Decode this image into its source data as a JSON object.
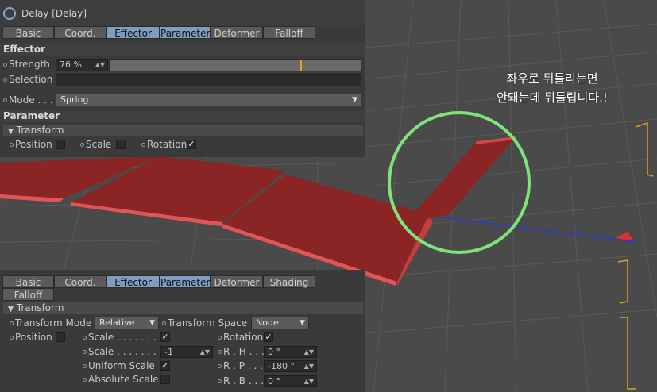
{
  "app": {
    "title": "Delay [Delay]",
    "logo_icon": "delay-effector-icon"
  },
  "top_panel": {
    "tabs": [
      {
        "label": "Basic",
        "active": false
      },
      {
        "label": "Coord.",
        "active": false
      },
      {
        "label": "Effector",
        "active": true
      },
      {
        "label": "Parameter",
        "active": true
      },
      {
        "label": "Deformer",
        "active": false
      },
      {
        "label": "Falloff",
        "active": false
      }
    ],
    "effector_section": "Effector",
    "strength_label": "Strength",
    "strength_value": "76 %",
    "strength_fraction": 0.76,
    "selection_label": "Selection",
    "selection_value": "",
    "mode_label": "Mode . . .",
    "mode_value": "Spring",
    "parameter_section": "Parameter",
    "transform_group": "Transform",
    "position_label": "Position",
    "scale_label": "Scale",
    "rotation_label": "Rotation",
    "rotation_check": "✓"
  },
  "bottom_panel": {
    "tabs": [
      {
        "label": "Basic",
        "active": false
      },
      {
        "label": "Coord.",
        "active": false
      },
      {
        "label": "Effector",
        "active": true
      },
      {
        "label": "Parameter",
        "active": true
      },
      {
        "label": "Deformer",
        "active": false
      },
      {
        "label": "Shading",
        "active": false
      }
    ],
    "falloff_tab": "Falloff",
    "transform_group": "Transform",
    "transform_mode_label": "Transform Mode",
    "transform_mode_value": "Relative",
    "transform_space_label": "Transform Space",
    "transform_space_value": "Node",
    "position_label": "Position",
    "scale_check_label": "Scale . . . . . . . .",
    "scale_check": "✓",
    "scale_value_label": "Scale . . . . . . . .",
    "scale_value": "-1",
    "uniform_scale_label": "Uniform Scale",
    "uniform_scale_check": "✓",
    "absolute_scale_label": "Absolute Scale",
    "rotation_label": "Rotation",
    "rotation_check": "✓",
    "rh_label": "R . H . . .",
    "rh_value": "0 °",
    "rp_label": "R . P . . .",
    "rp_value": "-180 °",
    "rb_label": "R . B . . .",
    "rb_value": "0 °"
  },
  "annotation": {
    "line1": "좌우로 뒤틀리는면",
    "line2": "안돼는데 뒤틀립니다.!",
    "highlight_color": "#7de37a"
  },
  "colors": {
    "plane": "#8b2525",
    "plane_edge": "#e05555",
    "accent_tab": "#7f9cc1",
    "strength_marker": "#e0a020"
  }
}
